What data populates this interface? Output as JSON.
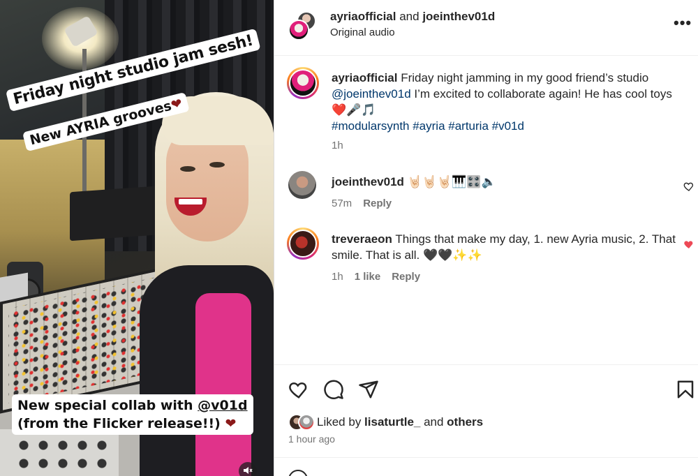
{
  "media": {
    "sticker_1": "Friday night studio jam sesh!",
    "sticker_2": "New AYRIA grooves",
    "sticker_2_heart": "❤",
    "sticker_3_line1_prefix": "New special collab with ",
    "sticker_3_mention": "@v01d",
    "sticker_3_line2": "(from the Flicker release!!) ",
    "sticker_3_heart": "❤",
    "mute_icon": "speaker-muted-icon"
  },
  "header": {
    "user1": "ayriaofficial",
    "joiner": " and ",
    "user2": "joeinthev01d",
    "audio": "Original audio",
    "more_icon": "•••"
  },
  "caption": {
    "username": "ayriaofficial",
    "text_1": " Friday night jamming in my good friend’s studio ",
    "mention": "@joeinthev01d",
    "text_2": " I’m excited to collaborate again! He has cool toys ❤️🎤🎵",
    "hashtags": "#modularsynth #ayria #arturia #v01d",
    "time": "1h"
  },
  "comments": [
    {
      "username": "joeinthev01d",
      "text": " 🤘🏻🤘🏻🤘🏻🎹🎛️🔈",
      "time": "57m",
      "reply": "Reply",
      "liked": false
    },
    {
      "username": "treveraeon",
      "text": " Things that make my day, 1. new Ayria music, 2. That smile. That is all. 🖤🖤✨✨",
      "time": "1h",
      "likes": "1 like",
      "reply": "Reply",
      "liked": true
    }
  ],
  "footer": {
    "liked_prefix": "Liked by ",
    "liked_user": "lisaturtle_",
    "liked_mid": " and ",
    "liked_others": "others",
    "time_ago": "1 hour ago"
  },
  "colors": {
    "link": "#00376b",
    "like_red": "#ed4956",
    "muted_text": "#737373"
  }
}
